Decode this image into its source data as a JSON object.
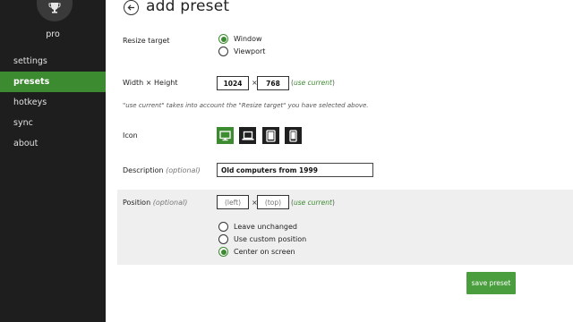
{
  "sidebar": {
    "brand": "pro",
    "items": [
      {
        "label": "settings"
      },
      {
        "label": "presets"
      },
      {
        "label": "hotkeys"
      },
      {
        "label": "sync"
      },
      {
        "label": "about"
      }
    ],
    "active_index": 1
  },
  "header": {
    "title": "add preset"
  },
  "resize_target": {
    "label": "Resize target",
    "options": [
      "Window",
      "Viewport"
    ],
    "selected": "Window"
  },
  "size": {
    "label": "Width × Height",
    "width": "1024",
    "height": "768",
    "times": "×",
    "paren_open": "(",
    "use_current": "use current",
    "paren_close": ")"
  },
  "hint": "\"use current\" takes into account the \"Resize target\" you have selected above.",
  "icon": {
    "label": "Icon",
    "options": [
      "desktop-icon",
      "laptop-icon",
      "tablet-icon",
      "phone-icon"
    ],
    "selected": "desktop-icon"
  },
  "description": {
    "label": "Description",
    "optional": "(optional)",
    "value": "Old computers from 1999"
  },
  "position": {
    "label": "Position",
    "optional": "(optional)",
    "left_placeholder": "(left)",
    "top_placeholder": "(top)",
    "times": "×",
    "paren_open": "(",
    "use_current": "use current",
    "paren_close": ")",
    "options": [
      "Leave unchanged",
      "Use custom position",
      "Center on screen"
    ],
    "selected": "Center on screen"
  },
  "save_label": "save preset",
  "colors": {
    "accent": "#3d8b30",
    "sidebar_bg": "#1e1e1e",
    "panel_bg": "#efefef"
  }
}
